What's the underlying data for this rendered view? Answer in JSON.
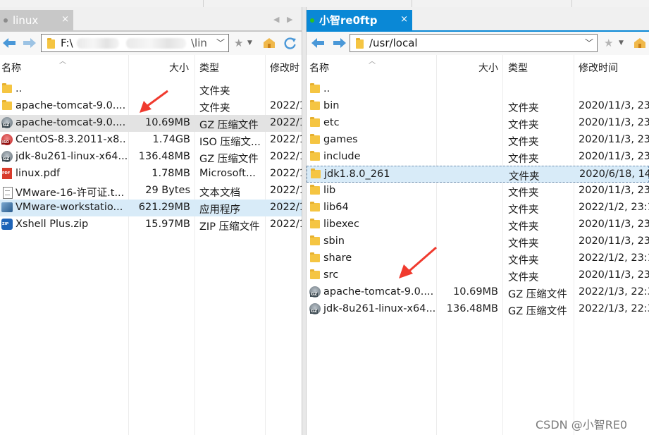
{
  "colors": {
    "accent": "#0a88d6",
    "annotation_arrow": "#f03a2e",
    "selection_blue": "#d8ebf8",
    "selection_gray": "#e3e3e3"
  },
  "left_pane": {
    "tab_title": "linux",
    "tab_close": "×",
    "tab_nav_prev": "◀",
    "tab_nav_next": "▶",
    "path": "F:\\",
    "path_tail": "\\lin",
    "columns": {
      "name": "名称",
      "size": "大小",
      "type": "类型",
      "modified": "修改时"
    },
    "rows": [
      {
        "icon": "folder-icon",
        "name": "..",
        "size": "",
        "type": "文件夹",
        "modified": ""
      },
      {
        "icon": "folder-icon",
        "name": "apache-tomcat-9.0....",
        "size": "",
        "type": "文件夹",
        "modified": "2022/1"
      },
      {
        "icon": "gz-archive-icon",
        "name": "apache-tomcat-9.0....",
        "size": "10.69MB",
        "type": "GZ 压缩文件",
        "modified": "2022/1"
      },
      {
        "icon": "iso-archive-icon",
        "name": "CentOS-8.3.2011-x8...",
        "size": "1.74GB",
        "type": "ISO 压缩文...",
        "modified": "2022/1"
      },
      {
        "icon": "gz-archive-icon",
        "name": "jdk-8u261-linux-x64...",
        "size": "136.48MB",
        "type": "GZ 压缩文件",
        "modified": "2022/1"
      },
      {
        "icon": "pdf-icon",
        "name": "linux.pdf",
        "size": "1.78MB",
        "type": "Microsoft...",
        "modified": "2022/1"
      },
      {
        "icon": "text-file-icon",
        "name": "VMware-16-许可证.t...",
        "size": "29 Bytes",
        "type": "文本文档",
        "modified": "2022/1"
      },
      {
        "icon": "application-icon",
        "name": "VMware-workstatio...",
        "size": "621.29MB",
        "type": "应用程序",
        "modified": "2022/1"
      },
      {
        "icon": "zip-archive-icon",
        "name": "Xshell Plus.zip",
        "size": "15.97MB",
        "type": "ZIP 压缩文件",
        "modified": "2022/1"
      }
    ]
  },
  "right_pane": {
    "tab_title": "小智re0ftp",
    "tab_close": "×",
    "path": "/usr/local",
    "columns": {
      "name": "名称",
      "size": "大小",
      "type": "类型",
      "modified": "修改时间"
    },
    "rows": [
      {
        "icon": "folder-icon",
        "name": "..",
        "size": "",
        "type": "",
        "modified": ""
      },
      {
        "icon": "folder-icon",
        "name": "bin",
        "size": "",
        "type": "文件夹",
        "modified": "2020/11/3, 23"
      },
      {
        "icon": "folder-icon",
        "name": "etc",
        "size": "",
        "type": "文件夹",
        "modified": "2020/11/3, 23"
      },
      {
        "icon": "folder-icon",
        "name": "games",
        "size": "",
        "type": "文件夹",
        "modified": "2020/11/3, 23"
      },
      {
        "icon": "folder-icon",
        "name": "include",
        "size": "",
        "type": "文件夹",
        "modified": "2020/11/3, 23"
      },
      {
        "icon": "folder-icon",
        "name": "jdk1.8.0_261",
        "size": "",
        "type": "文件夹",
        "modified": "2020/6/18, 14"
      },
      {
        "icon": "folder-icon",
        "name": "lib",
        "size": "",
        "type": "文件夹",
        "modified": "2020/11/3, 23"
      },
      {
        "icon": "folder-icon",
        "name": "lib64",
        "size": "",
        "type": "文件夹",
        "modified": "2022/1/2, 23:1"
      },
      {
        "icon": "folder-icon",
        "name": "libexec",
        "size": "",
        "type": "文件夹",
        "modified": "2020/11/3, 23"
      },
      {
        "icon": "folder-icon",
        "name": "sbin",
        "size": "",
        "type": "文件夹",
        "modified": "2020/11/3, 23"
      },
      {
        "icon": "folder-icon",
        "name": "share",
        "size": "",
        "type": "文件夹",
        "modified": "2022/1/2, 23:1"
      },
      {
        "icon": "folder-icon",
        "name": "src",
        "size": "",
        "type": "文件夹",
        "modified": "2020/11/3, 23"
      },
      {
        "icon": "gz-archive-icon",
        "name": "apache-tomcat-9.0....",
        "size": "10.69MB",
        "type": "GZ 压缩文件",
        "modified": "2022/1/3, 22:3"
      },
      {
        "icon": "gz-archive-icon",
        "name": "jdk-8u261-linux-x64...",
        "size": "136.48MB",
        "type": "GZ 压缩文件",
        "modified": "2022/1/3, 22:3"
      }
    ]
  },
  "watermark": "CSDN @小智RE0"
}
